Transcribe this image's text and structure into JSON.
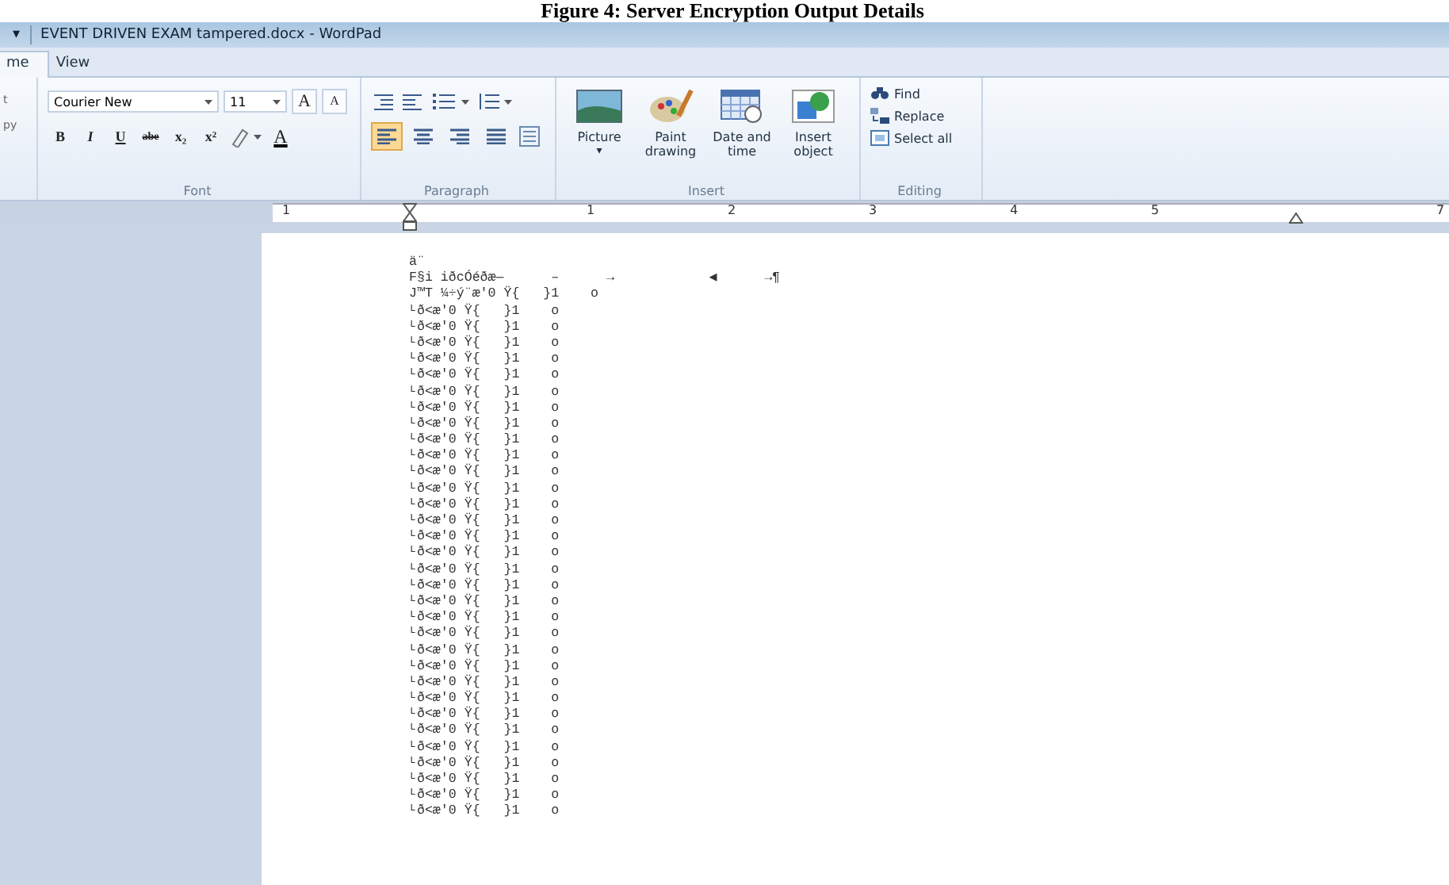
{
  "caption": "Figure 4: Server Encryption Output Details",
  "window": {
    "quick_access": "▾",
    "title": "EVENT DRIVEN EXAM tampered.docx - WordPad"
  },
  "tabs": [
    {
      "label": "me",
      "selected": true
    },
    {
      "label": "View",
      "selected": false
    }
  ],
  "ribbon": {
    "clipboard_fragments": [
      "t",
      "py"
    ],
    "font": {
      "name": "Courier New",
      "size": "11",
      "grow": "A",
      "shrink": "A",
      "styles": [
        "B",
        "I",
        "U",
        "abe",
        "x₂",
        "x²"
      ],
      "color_letter": "A",
      "label": "Font"
    },
    "paragraph": {
      "align": [
        {
          "kind": "left",
          "selected": true
        },
        {
          "kind": "center",
          "selected": false
        },
        {
          "kind": "right",
          "selected": false
        },
        {
          "kind": "justify",
          "selected": false
        }
      ],
      "label": "Paragraph"
    },
    "insert": {
      "items": [
        {
          "kind": "picture",
          "label": "Picture",
          "caret": "▾"
        },
        {
          "kind": "paint",
          "label": "Paint drawing"
        },
        {
          "kind": "datetime",
          "label": "Date and time"
        },
        {
          "kind": "object",
          "label": "Insert object"
        }
      ],
      "label": "Insert"
    },
    "editing": {
      "items": [
        {
          "kind": "find",
          "label": "Find"
        },
        {
          "kind": "replace",
          "label": "Replace"
        },
        {
          "kind": "select",
          "label": "Select all"
        }
      ],
      "label": "Editing"
    }
  },
  "ruler": [
    "1",
    "1",
    "2",
    "3",
    "4",
    "5",
    "7"
  ],
  "document": {
    "lines": [
      "ä¨",
      "F§i iðcÓéðæ—      –      →            ◀      →¶",
      "J™T ¼÷ý¨æ'0 Ÿ{   }1    o",
      "ᴸð<æ'0 Ÿ{   }1    o",
      "ᴸð<æ'0 Ÿ{   }1    o",
      "ᴸð<æ'0 Ÿ{   }1    o",
      "ᴸð<æ'0 Ÿ{   }1    o",
      "ᴸð<æ'0 Ÿ{   }1    o",
      "ᴸð<æ'0 Ÿ{   }1    o",
      "ᴸð<æ'0 Ÿ{   }1    o",
      "ᴸð<æ'0 Ÿ{   }1    o",
      "ᴸð<æ'0 Ÿ{   }1    o",
      "ᴸð<æ'0 Ÿ{   }1    o",
      "ᴸð<æ'0 Ÿ{   }1    o",
      "ᴸð<æ'0 Ÿ{   }1    o",
      "ᴸð<æ'0 Ÿ{   }1    o",
      "ᴸð<æ'0 Ÿ{   }1    o",
      "ᴸð<æ'0 Ÿ{   }1    o",
      "ᴸð<æ'0 Ÿ{   }1    o",
      "ᴸð<æ'0 Ÿ{   }1    o",
      "ᴸð<æ'0 Ÿ{   }1    o",
      "ᴸð<æ'0 Ÿ{   }1    o",
      "ᴸð<æ'0 Ÿ{   }1    o",
      "ᴸð<æ'0 Ÿ{   }1    o",
      "ᴸð<æ'0 Ÿ{   }1    o",
      "ᴸð<æ'0 Ÿ{   }1    o",
      "ᴸð<æ'0 Ÿ{   }1    o",
      "ᴸð<æ'0 Ÿ{   }1    o",
      "ᴸð<æ'0 Ÿ{   }1    o",
      "ᴸð<æ'0 Ÿ{   }1    o",
      "ᴸð<æ'0 Ÿ{   }1    o",
      "ᴸð<æ'0 Ÿ{   }1    o",
      "ᴸð<æ'0 Ÿ{   }1    o",
      "ᴸð<æ'0 Ÿ{   }1    o",
      "ᴸð<æ'0 Ÿ{   }1    o"
    ]
  }
}
